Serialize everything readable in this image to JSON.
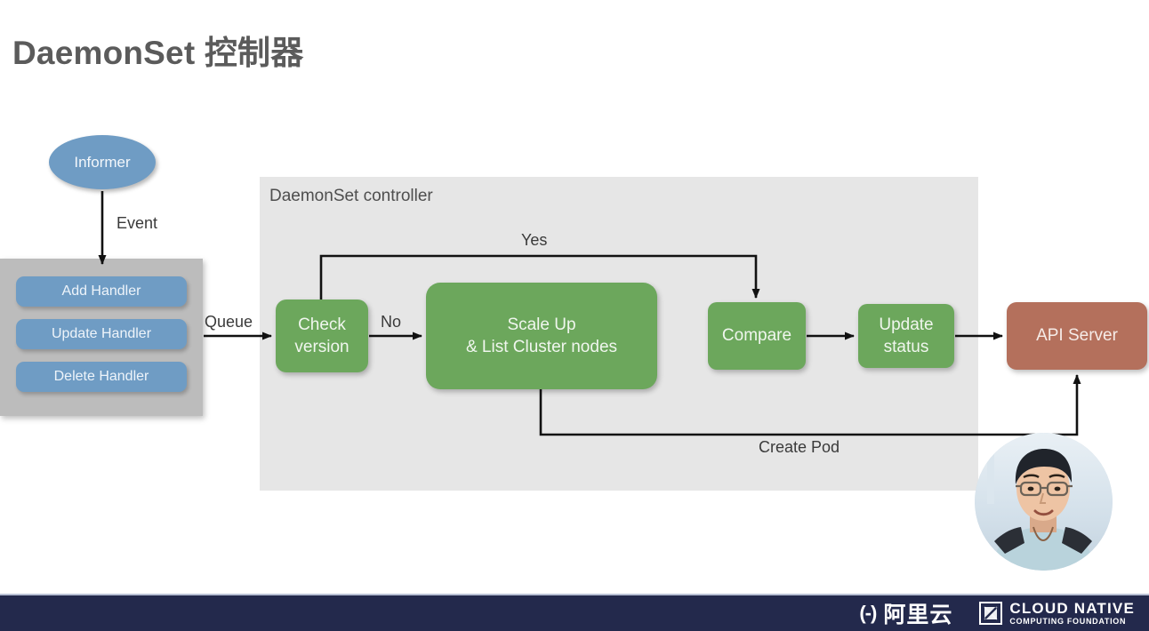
{
  "slide": {
    "title": "DaemonSet 控制器"
  },
  "diagram": {
    "informer": {
      "label": "Informer"
    },
    "handler_panel": {
      "items": [
        {
          "label": "Add Handler"
        },
        {
          "label": "Update Handler"
        },
        {
          "label": "Delete Handler"
        }
      ]
    },
    "controller_panel": {
      "title": "DaemonSet controller",
      "boxes": [
        {
          "id": "check",
          "label": "Check\nversion"
        },
        {
          "id": "scale",
          "label": "Scale Up\n& List Cluster nodes"
        },
        {
          "id": "compare",
          "label": "Compare"
        },
        {
          "id": "update",
          "label": "Update\nstatus"
        }
      ]
    },
    "api_server": {
      "label": "API Server"
    },
    "edge_labels": {
      "event": "Event",
      "queue": "Queue",
      "no": "No",
      "yes": "Yes",
      "create_pod": "Create  Pod"
    },
    "colors": {
      "process_green": "#6ca75c",
      "informer_blue": "#6f9cc4",
      "handler_blue": "#6f9cc4",
      "handler_panel_gray": "#bcbcbc",
      "controller_panel_gray": "#e6e6e6",
      "api_server_brown": "#b4705c",
      "arrow_black": "#111111",
      "title_gray": "#5b5b5b",
      "footer_navy": "#23294c"
    }
  },
  "webcam": {
    "label": "presenter-video-bubble"
  },
  "footer": {
    "aliyun": {
      "mark": "(-)",
      "text": "阿里云"
    },
    "cncf": {
      "title": "CLOUD NATIVE",
      "subtitle": "COMPUTING FOUNDATION"
    }
  }
}
